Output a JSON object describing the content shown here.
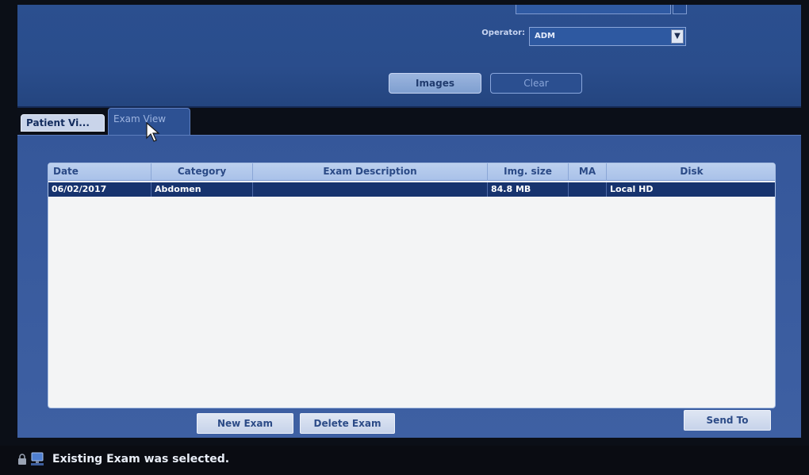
{
  "top_panel": {
    "operator_label": "Operator:",
    "operator_value": "ADM",
    "images_button": "Images",
    "clear_button": "Clear"
  },
  "tabs": [
    {
      "label": "Patient Vi..."
    },
    {
      "label": "Exam View"
    }
  ],
  "table": {
    "headers": [
      "Date",
      "Category",
      "Exam Description",
      "Img. size",
      "MA",
      "Disk"
    ],
    "rows": [
      {
        "date": "06/02/2017",
        "category": "Abdomen",
        "description": "",
        "size": "84.8 MB",
        "ma": "",
        "disk": "Local HD"
      }
    ]
  },
  "buttons": {
    "new_exam": "New Exam",
    "delete_exam": "Delete Exam",
    "send_to": "Send To"
  },
  "status": {
    "message": "Existing Exam was selected."
  },
  "icons": {
    "status_lock": "lock-icon",
    "status_network": "network-icon",
    "operator_dropdown": "chevron-down-icon",
    "pointer": "cursor-icon"
  }
}
